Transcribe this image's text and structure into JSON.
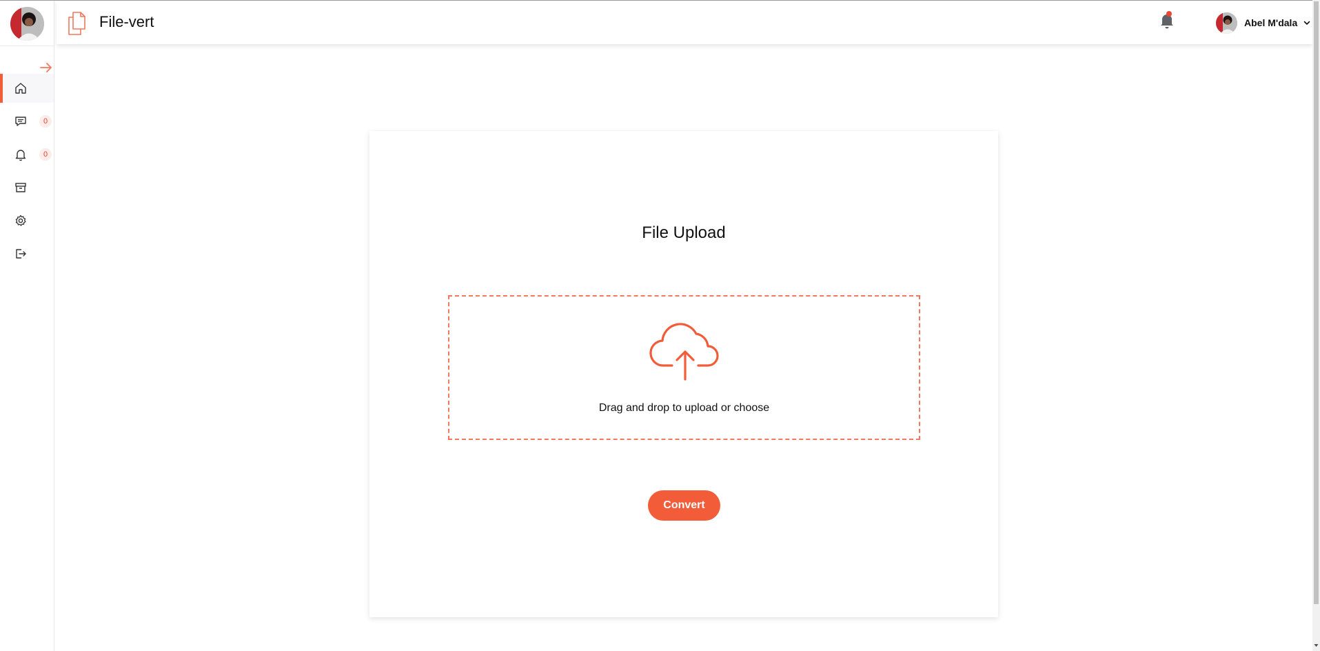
{
  "app": {
    "title": "File-vert",
    "accent_color": "#f25c38"
  },
  "header": {
    "user_name": "Abel M'dala",
    "notification_icon": "bell-icon"
  },
  "sidebar": {
    "collapse_icon": "arrow-right-icon",
    "items": [
      {
        "icon": "home-icon",
        "active": true
      },
      {
        "icon": "chat-icon",
        "badge": "0"
      },
      {
        "icon": "bell-icon",
        "badge": "0"
      },
      {
        "icon": "archive-icon"
      },
      {
        "icon": "gear-icon"
      },
      {
        "icon": "logout-icon"
      }
    ]
  },
  "upload": {
    "title": "File Upload",
    "drop_text": "Drag and drop to upload or choose",
    "convert_label": "Convert"
  }
}
